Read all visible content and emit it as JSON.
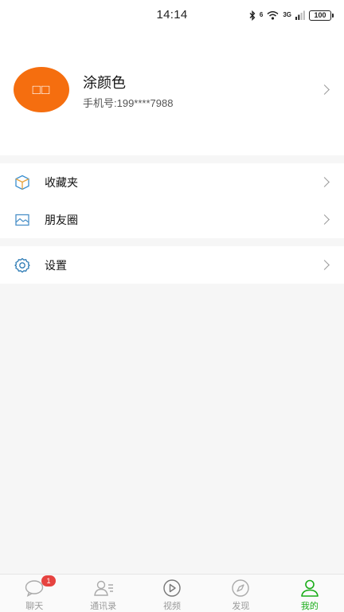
{
  "status_bar": {
    "time": "14:14",
    "network_label": "3G",
    "wifi_label": "6",
    "battery": "100"
  },
  "profile": {
    "avatar_text": "□□",
    "name": "涂颜色",
    "phone": "手机号:199****7988",
    "avatar_color": "#f56e0f"
  },
  "menu": {
    "group1": [
      {
        "label": "收藏夹",
        "icon": "cube-icon"
      },
      {
        "label": "朋友圈",
        "icon": "image-icon"
      }
    ],
    "group2": [
      {
        "label": "设置",
        "icon": "gear-icon"
      }
    ]
  },
  "tabs": [
    {
      "label": "聊天",
      "icon": "chat-bubble-icon",
      "badge": "1"
    },
    {
      "label": "通讯录",
      "icon": "contacts-icon"
    },
    {
      "label": "视频",
      "icon": "play-circle-icon"
    },
    {
      "label": "发现",
      "icon": "compass-icon"
    },
    {
      "label": "我的",
      "icon": "person-icon",
      "active": true
    }
  ],
  "colors": {
    "accent": "#1aad19",
    "badge": "#e64340",
    "background": "#f6f6f6"
  }
}
